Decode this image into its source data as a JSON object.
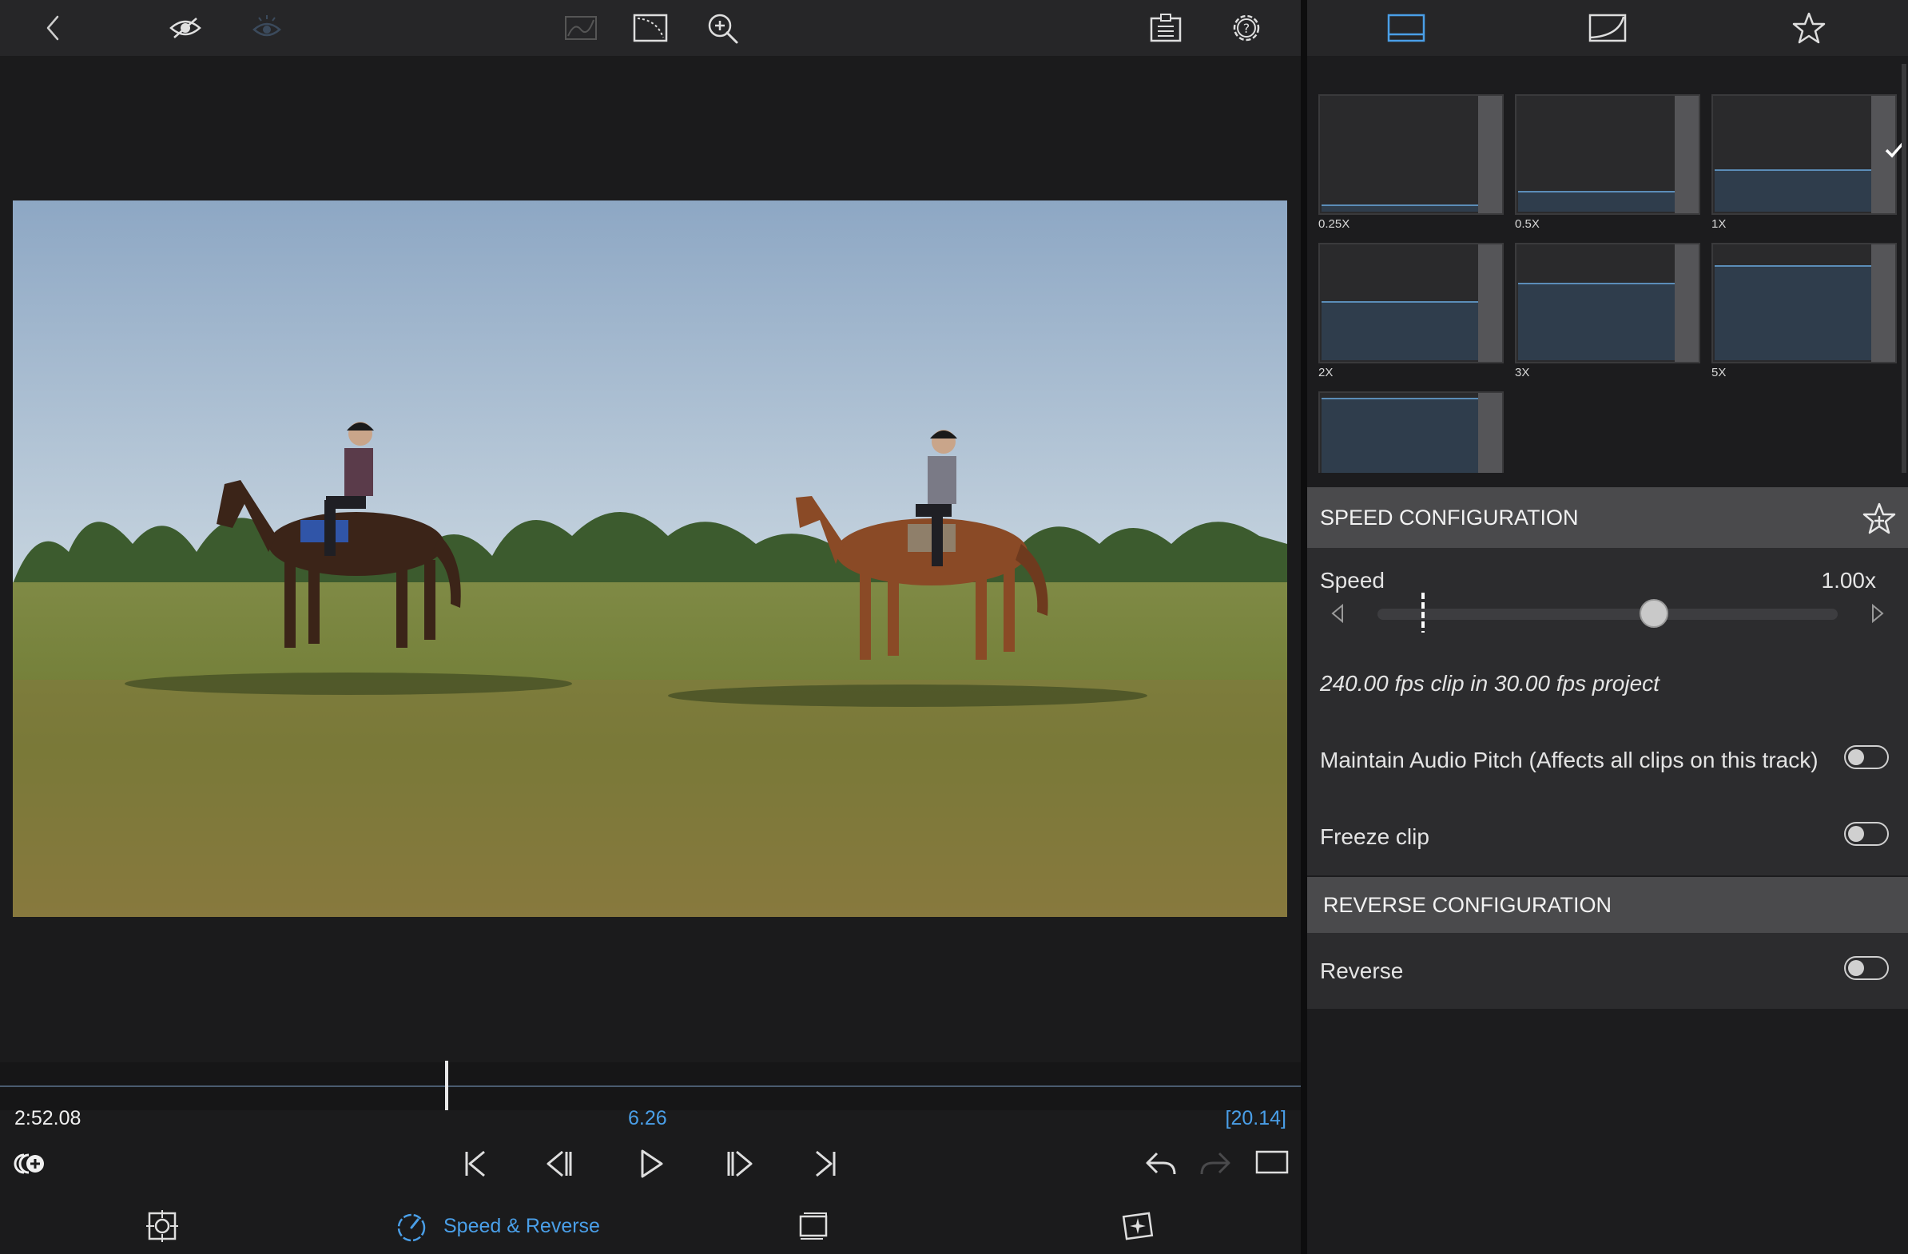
{
  "colors": {
    "accent": "#4a9fe8",
    "panel": "#2c2c2e",
    "header": "#4a4a4c",
    "toolbar": "#262628"
  },
  "toolbar": {
    "icons": [
      "back-icon",
      "eye-icon",
      "eye-dim-icon",
      "auto-curve-icon",
      "keyframe-curve-icon",
      "zoom-icon",
      "clipboard-icon",
      "settings-help-icon"
    ]
  },
  "timeline": {
    "current_time": "2:52.08",
    "playhead_time": "6.26",
    "duration": "[20.14]"
  },
  "bottom_toolbar": {
    "speed_reverse_label": "Speed & Reverse"
  },
  "inspector": {
    "tabs": [
      "speed-tab-icon",
      "curve-tab-icon",
      "favorites-star-icon"
    ],
    "presets": [
      {
        "label": "0.25X",
        "level": 0.06
      },
      {
        "label": "0.5X",
        "level": 0.18
      },
      {
        "label": "1X",
        "level": 0.37,
        "selected": true
      },
      {
        "label": "2X",
        "level": 0.52
      },
      {
        "label": "3X",
        "level": 0.68
      },
      {
        "label": "5X",
        "level": 0.83
      },
      {
        "label": "",
        "level": 0.97
      }
    ],
    "speed_section": {
      "title": "SPEED CONFIGURATION",
      "speed_label": "Speed",
      "speed_value": "1.00x",
      "speed_fraction": 0.6,
      "fps_info": "240.00 fps clip in 30.00 fps project",
      "maintain_pitch_label": "Maintain Audio Pitch (Affects all clips on this track)",
      "maintain_pitch_on": false,
      "freeze_label": "Freeze clip",
      "freeze_on": false
    },
    "reverse_section": {
      "title": "REVERSE CONFIGURATION",
      "reverse_label": "Reverse",
      "reverse_on": false
    }
  }
}
